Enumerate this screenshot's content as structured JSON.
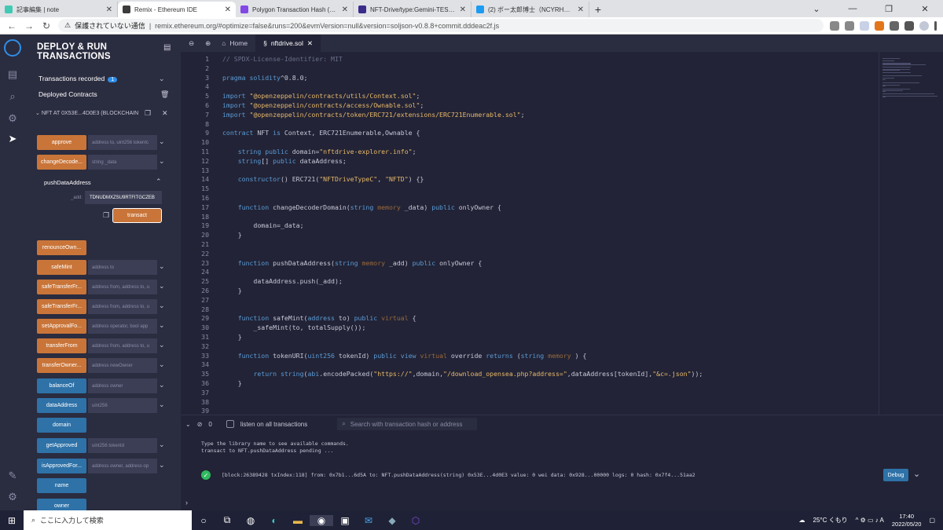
{
  "browser": {
    "tabs": [
      {
        "title": "記事編集 | note",
        "color": "#41c9b4",
        "active": false
      },
      {
        "title": "Remix - Ethereum IDE",
        "color": "#3c3c3c",
        "active": true
      },
      {
        "title": "Polygon Transaction Hash (Txhas",
        "color": "#8247e5",
        "active": false
      },
      {
        "title": "NFT-Drive/type:Gemini-TEST_NF",
        "color": "#3b2b8a",
        "active": false
      },
      {
        "title": "(2) ボー太郎博士（NCYRHFYAW",
        "color": "#1d9bf0",
        "active": false
      }
    ],
    "new_tab": "+",
    "url_warning": "保護されていない通信",
    "url": "remix.ethereum.org/#optimize=false&runs=200&evmVersion=null&version=soljson-v0.8.8+commit.dddeac2f.js"
  },
  "panel": {
    "title": "DEPLOY & RUN TRANSACTIONS",
    "tx_recorded_label": "Transactions recorded",
    "tx_recorded_count": "1",
    "deployed_label": "Deployed Contracts",
    "contract_label": "NFT AT 0X53E...4D0E3 (BLOCKCHAIN",
    "functions": [
      {
        "label": "approve",
        "args": "address to, uint256 tokenIc",
        "color": "orange",
        "expand": true
      },
      {
        "label": "changeDecode...",
        "args": "string _data",
        "color": "orange",
        "expand": true
      },
      {
        "label": "renounceOwn...",
        "args": "",
        "color": "orange",
        "expand": false
      },
      {
        "label": "safeMint",
        "args": "address to",
        "color": "orange",
        "expand": true
      },
      {
        "label": "safeTransferFr...",
        "args": "address from, address to, u",
        "color": "orange",
        "expand": true
      },
      {
        "label": "safeTransferFr...",
        "args": "address from, address to, u",
        "color": "orange",
        "expand": true
      },
      {
        "label": "setApprovalFo...",
        "args": "address operator, bool app",
        "color": "orange",
        "expand": true
      },
      {
        "label": "transferFrom",
        "args": "address from, address to, u",
        "color": "orange",
        "expand": true
      },
      {
        "label": "transferOwner...",
        "args": "address newOwner",
        "color": "orange",
        "expand": true
      },
      {
        "label": "balanceOf",
        "args": "address owner",
        "color": "blue",
        "expand": true
      },
      {
        "label": "dataAddress",
        "args": "uint256",
        "color": "blue",
        "expand": true
      },
      {
        "label": "domain",
        "args": "",
        "color": "blue",
        "expand": false
      },
      {
        "label": "getApproved",
        "args": "uint256 tokenId",
        "color": "blue",
        "expand": true
      },
      {
        "label": "isApprovedFor...",
        "args": "address owner, address op",
        "color": "blue",
        "expand": true
      },
      {
        "label": "name",
        "args": "",
        "color": "blue",
        "expand": false
      },
      {
        "label": "owner",
        "args": "",
        "color": "blue",
        "expand": false
      }
    ],
    "expanded_fn": {
      "title": "pushDataAddress",
      "param_label": "_add:",
      "param_value": "TDNUDMXZSU9RTFITGCZEB",
      "transact_label": "transact"
    }
  },
  "editor": {
    "tabs": [
      {
        "label": "Home",
        "icon": "home-icon"
      },
      {
        "label": "nftdrive.sol",
        "icon": "file-icon",
        "active": true
      }
    ],
    "lines": [
      [
        [
          "com",
          "// SPDX-License-Identifier: MIT"
        ]
      ],
      [],
      [
        [
          "kw",
          "pragma solidity"
        ],
        [
          "",
          "^0.8.0;"
        ]
      ],
      [],
      [
        [
          "kw",
          "import"
        ],
        [
          "",
          " "
        ],
        [
          "str",
          "\"@openzeppelin/contracts/utils/Context.sol\""
        ],
        [
          "",
          ";"
        ]
      ],
      [
        [
          "kw",
          "import"
        ],
        [
          "",
          " "
        ],
        [
          "str",
          "\"@openzeppelin/contracts/access/Ownable.sol\""
        ],
        [
          "",
          ";"
        ]
      ],
      [
        [
          "kw",
          "import"
        ],
        [
          "",
          " "
        ],
        [
          "str",
          "\"@openzeppelin/contracts/token/ERC721/extensions/ERC721Enumerable.sol\""
        ],
        [
          "",
          ";"
        ]
      ],
      [],
      [
        [
          "kw",
          "contract"
        ],
        [
          "",
          " NFT "
        ],
        [
          "kw",
          "is"
        ],
        [
          "",
          " Context, ERC721Enumerable,Ownable {"
        ]
      ],
      [],
      [
        [
          "",
          "    "
        ],
        [
          "ty",
          "string"
        ],
        [
          "",
          " "
        ],
        [
          "kw",
          "public"
        ],
        [
          "",
          " domain="
        ],
        [
          "str",
          "\"nftdrive-explorer.info\""
        ],
        [
          "",
          ";"
        ]
      ],
      [
        [
          "",
          "    "
        ],
        [
          "ty",
          "string"
        ],
        [
          "",
          "[] "
        ],
        [
          "kw",
          "public"
        ],
        [
          "",
          " dataAddress;"
        ]
      ],
      [],
      [
        [
          "",
          "    "
        ],
        [
          "kw",
          "constructor"
        ],
        [
          "",
          "() ERC721("
        ],
        [
          "str",
          "\"NFTDriveTypeC\""
        ],
        [
          "",
          ", "
        ],
        [
          "str",
          "\"NFTD\""
        ],
        [
          "",
          ") {}"
        ]
      ],
      [],
      [],
      [
        [
          "",
          "    "
        ],
        [
          "kw",
          "function"
        ],
        [
          "",
          " changeDecoderDomain("
        ],
        [
          "ty",
          "string"
        ],
        [
          "",
          " "
        ],
        [
          "dim",
          "memory"
        ],
        [
          "",
          " _data) "
        ],
        [
          "kw",
          "public"
        ],
        [
          "",
          " onlyOwner {"
        ]
      ],
      [],
      [
        [
          "",
          "        domain=_data;"
        ]
      ],
      [
        [
          "",
          "    }"
        ]
      ],
      [],
      [],
      [
        [
          "",
          "    "
        ],
        [
          "kw",
          "function"
        ],
        [
          "",
          " pushDataAddress("
        ],
        [
          "ty",
          "string"
        ],
        [
          "",
          " "
        ],
        [
          "dim",
          "memory"
        ],
        [
          "",
          " _add) "
        ],
        [
          "kw",
          "public"
        ],
        [
          "",
          " onlyOwner {"
        ]
      ],
      [],
      [
        [
          "",
          "        dataAddress.push(_add);"
        ]
      ],
      [
        [
          "",
          "    }"
        ]
      ],
      [],
      [],
      [
        [
          "",
          "    "
        ],
        [
          "kw",
          "function"
        ],
        [
          "",
          " safeMint("
        ],
        [
          "ty",
          "address"
        ],
        [
          "",
          " to) "
        ],
        [
          "kw",
          "public"
        ],
        [
          "",
          " "
        ],
        [
          "dim",
          "virtual"
        ],
        [
          "",
          " {"
        ]
      ],
      [
        [
          "",
          "        _safeMint(to, totalSupply());"
        ]
      ],
      [
        [
          "",
          "    }"
        ]
      ],
      [],
      [
        [
          "",
          "    "
        ],
        [
          "kw",
          "function"
        ],
        [
          "",
          " tokenURI("
        ],
        [
          "ty",
          "uint256"
        ],
        [
          "",
          " tokenId) "
        ],
        [
          "kw",
          "public"
        ],
        [
          "",
          " "
        ],
        [
          "kw",
          "view"
        ],
        [
          "",
          " "
        ],
        [
          "dim",
          "virtual"
        ],
        [
          "",
          " override "
        ],
        [
          "kw",
          "returns"
        ],
        [
          "",
          " ("
        ],
        [
          "ty",
          "string"
        ],
        [
          "",
          " "
        ],
        [
          "dim",
          "memory"
        ],
        [
          "",
          " ) {"
        ]
      ],
      [],
      [
        [
          "",
          "        "
        ],
        [
          "kw",
          "return"
        ],
        [
          "",
          " "
        ],
        [
          "ty",
          "string"
        ],
        [
          "",
          "("
        ],
        [
          "kw",
          "abi"
        ],
        [
          "",
          ".encodePacked("
        ],
        [
          "str",
          "\"https://\""
        ],
        [
          "",
          ",domain,"
        ],
        [
          "str",
          "\"/download_opensea.php?address=\""
        ],
        [
          "",
          ",dataAddress[tokenId],"
        ],
        [
          "str",
          "\"&c=.json\""
        ],
        [
          "",
          "));"
        ]
      ],
      [
        [
          "",
          "    }"
        ]
      ],
      [],
      [],
      []
    ]
  },
  "terminal": {
    "count": "0",
    "listen_label": "listen on all transactions",
    "search_placeholder": "Search with transaction hash or address",
    "info1": "Type the library name to see available commands.",
    "info2": "transact to NFT.pushDataAddress pending ...",
    "tx_summary": "[block:26389428 txIndex:118] from: 0x7b1...6d5A to: NFT.pushDataAddress(string) 0x53E...4d0E3 value: 0 wei data: 0x928...00000 logs: 0 hash: 0x7f4...51aa2",
    "debug_label": "Debug"
  },
  "taskbar": {
    "search_placeholder": "ここに入力して検索",
    "weather": "25°C くもり",
    "time": "17:40",
    "date": "2022/05/20"
  }
}
